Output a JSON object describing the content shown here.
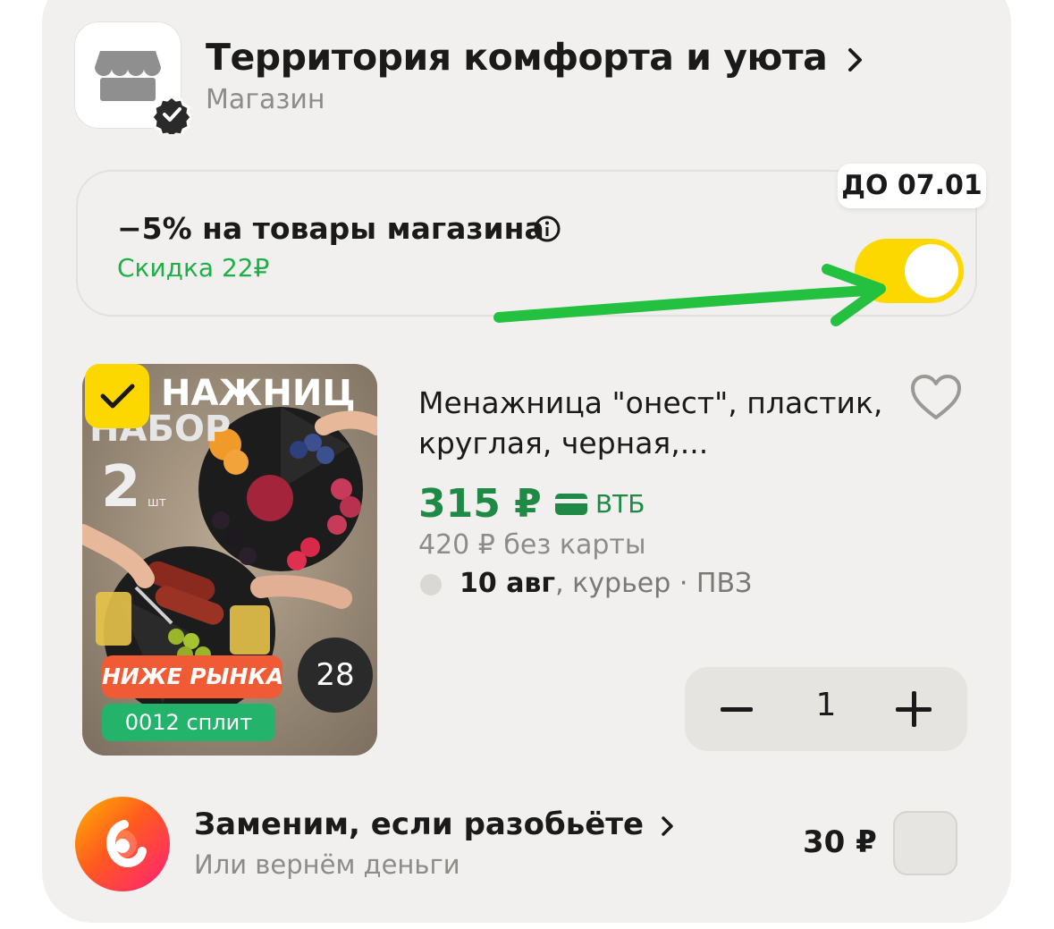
{
  "store": {
    "name": "Территория комфорта и уюта",
    "type": "Магазин",
    "logo_icon": "storefront-icon",
    "verified_icon": "verified-badge-icon"
  },
  "promo": {
    "title": "−5% на товары магазина",
    "discount": "Скидка 22₽",
    "valid_until": "ДО 07.01",
    "toggle_on": true
  },
  "product": {
    "selected": true,
    "name": "Менажница \"онест\", пластик, круглая, черная,...",
    "price": "315 ₽",
    "bank": "ВТБ",
    "price_without_card": "420 ₽ без карты",
    "delivery_date": "10 авг",
    "delivery_method": ", курьер · ПВЗ",
    "quantity": "1",
    "image": {
      "text_top_1": "НАЖНИЦ",
      "text_top_2": "НАБОР",
      "count": "2",
      "count_unit": "шт",
      "badge_market": "НИЖЕ РЫНКА",
      "badge_split": "0012 сплит",
      "diameter": "28"
    }
  },
  "insurance": {
    "title": "Заменим, если разобьёте",
    "subtitle": "Или вернём деньги",
    "price": "30 ₽",
    "selected": false
  },
  "colors": {
    "accent_yellow": "#fcd800",
    "green": "#1db046",
    "price_green": "#1f8a45",
    "background": "#f1f0ee"
  }
}
